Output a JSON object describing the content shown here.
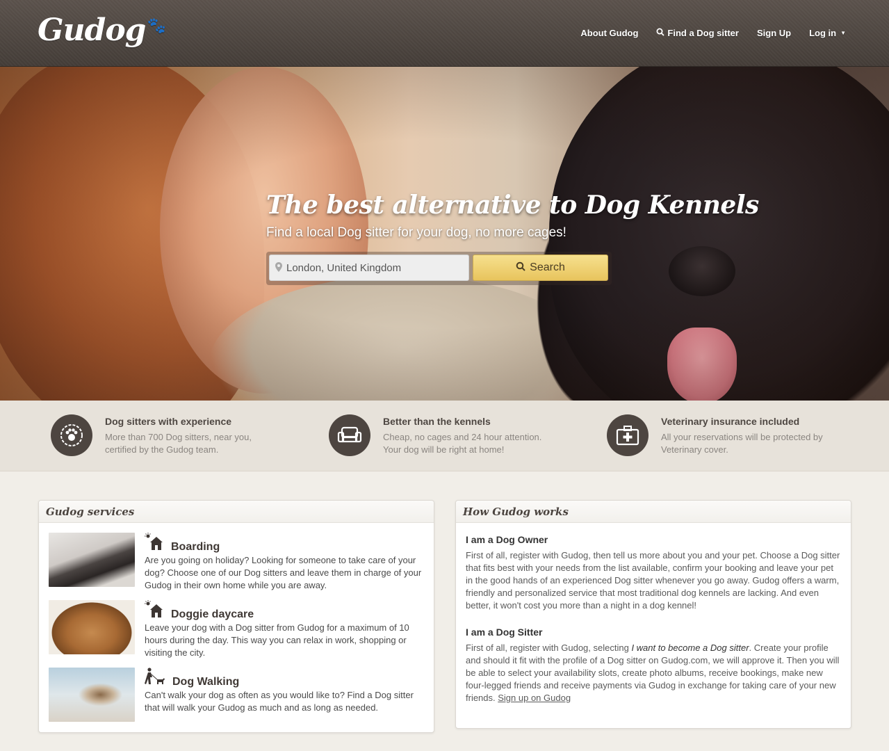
{
  "brand": {
    "logo": "Gudog"
  },
  "nav": {
    "about": "About Gudog",
    "find": "Find a Dog sitter",
    "signup": "Sign Up",
    "login": "Log in"
  },
  "hero": {
    "title": "The best alternative to Dog Kennels",
    "subtitle": "Find a local Dog sitter for your dog, no more cages!",
    "search_value": "London, United Kingdom",
    "search_button": "Search"
  },
  "features": [
    {
      "title": "Dog sitters with experience",
      "line1": "More than 700 Dog sitters, near you,",
      "line2": "certified by the Gudog team.",
      "icon": "paw-badge-icon"
    },
    {
      "title": "Better than the kennels",
      "line1": "Cheap, no cages and 24 hour attention.",
      "line2": "Your dog will be right at home!",
      "icon": "sofa-icon"
    },
    {
      "title": "Veterinary insurance included",
      "line1": "All your reservations will be protected by",
      "line2": "Veterinary cover.",
      "icon": "first-aid-kit-icon"
    }
  ],
  "services": {
    "heading": "Gudog services",
    "items": [
      {
        "name": "Boarding",
        "icon": "house-sun-icon",
        "text": "Are you going on holiday? Looking for someone to take care of your dog? Choose one of our Dog sitters and leave them in charge of your Gudog in their own home while you are away."
      },
      {
        "name": "Doggie daycare",
        "icon": "house-sun-icon",
        "text": "Leave your dog with a Dog sitter from Gudog for a maximum of 10 hours during the day. This way you can relax in work, shopping or visiting the city."
      },
      {
        "name": "Dog Walking",
        "icon": "person-walking-dog-icon",
        "text": "Can't walk your dog as often as you would like to? Find a Dog sitter that will walk your Gudog as much and as long as needed."
      }
    ]
  },
  "how": {
    "heading": "How Gudog works",
    "owner_title": "I am a Dog Owner",
    "owner_text": "First of all, register with Gudog, then tell us more about you and your pet. Choose a Dog sitter that fits best with your needs from the list available, confirm your booking and leave your pet in the good hands of an experienced Dog sitter whenever you go away. Gudog offers a warm, friendly and personalized service that most traditional dog kennels are lacking. And even better, it won't cost you more than a night in a dog kennel!",
    "sitter_title": "I am a Dog Sitter",
    "sitter_text_pre": "First of all, register with Gudog, selecting ",
    "sitter_text_em": "I want to become a Dog sitter",
    "sitter_text_post": ". Create your profile and should it fit with the profile of a Dog sitter on Gudog.com, we will approve it. Then you will be able to select your availability slots, create photo albums, receive bookings, make new four-legged friends and receive payments via Gudog in exchange for taking care of your new friends. ",
    "sitter_link": "Sign up on Gudog"
  }
}
